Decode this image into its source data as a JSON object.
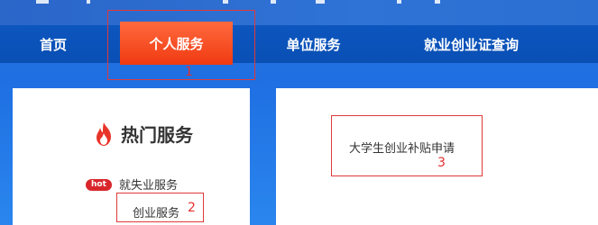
{
  "nav": {
    "items": [
      {
        "label": "首页"
      },
      {
        "label": "个人服务"
      },
      {
        "label": "单位服务"
      },
      {
        "label": "就业创业证查询"
      }
    ],
    "active_color": "#f24a1f",
    "bar_color": "#0b53bb"
  },
  "hot_services": {
    "title": "热门服务",
    "badge": "hot",
    "items": [
      {
        "label": "就失业服务"
      },
      {
        "label": "创业服务"
      }
    ]
  },
  "services": {
    "items": [
      {
        "label": "大学生创业补贴申请"
      }
    ]
  },
  "annotations": {
    "marker_1": "1",
    "marker_2": "2",
    "marker_3": "3",
    "color": "#e03a3a"
  }
}
